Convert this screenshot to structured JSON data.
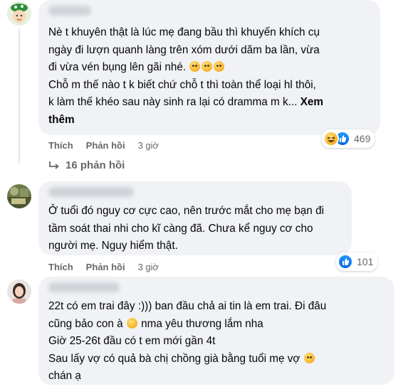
{
  "comments": [
    {
      "lines": [
        "Nè t khuyên thật là lúc mẹ đang bầu thì khuyến khích cụ",
        "ngày đi lượn quanh làng trên xóm dưới dăm ba lần, vừa",
        "đi vừa vén bụng lên gãi nhé. ",
        "Chỗ m thế nào t k biết chứ chỗ t thì toàn thể loại hl thôi,",
        "k làm thế khéo sau này sinh ra lại có dramma m k... "
      ],
      "see_more": "Xem",
      "see_more_2": "thêm",
      "like_label": "Thích",
      "reply_label": "Phản hồi",
      "time": "3 giờ",
      "reaction_count": "469",
      "replies_text": "16 phản hồi"
    },
    {
      "lines": [
        "Ở tuổi đó nguy cơ cực cao, nên trước mắt cho mẹ bạn đi",
        "tầm soát thai nhi cho kĩ càng đã. Chưa kể nguy cơ cho",
        "người mẹ. Nguy hiểm thật."
      ],
      "like_label": "Thích",
      "reply_label": "Phản hồi",
      "time": "3 giờ",
      "reaction_count": "101"
    },
    {
      "lines": [
        "22t có em trai đây :))) ban đầu chả ai tin là em trai. Đi đâu",
        "cũng bảo con à ",
        " nma yêu thương lắm nha",
        "Giờ 25-26t đầu có t em mới gần 4t",
        "Sau lấy vợ có quả bà chị chồng già bằng tuổi mẹ vợ ",
        "chán ạ"
      ]
    }
  ]
}
